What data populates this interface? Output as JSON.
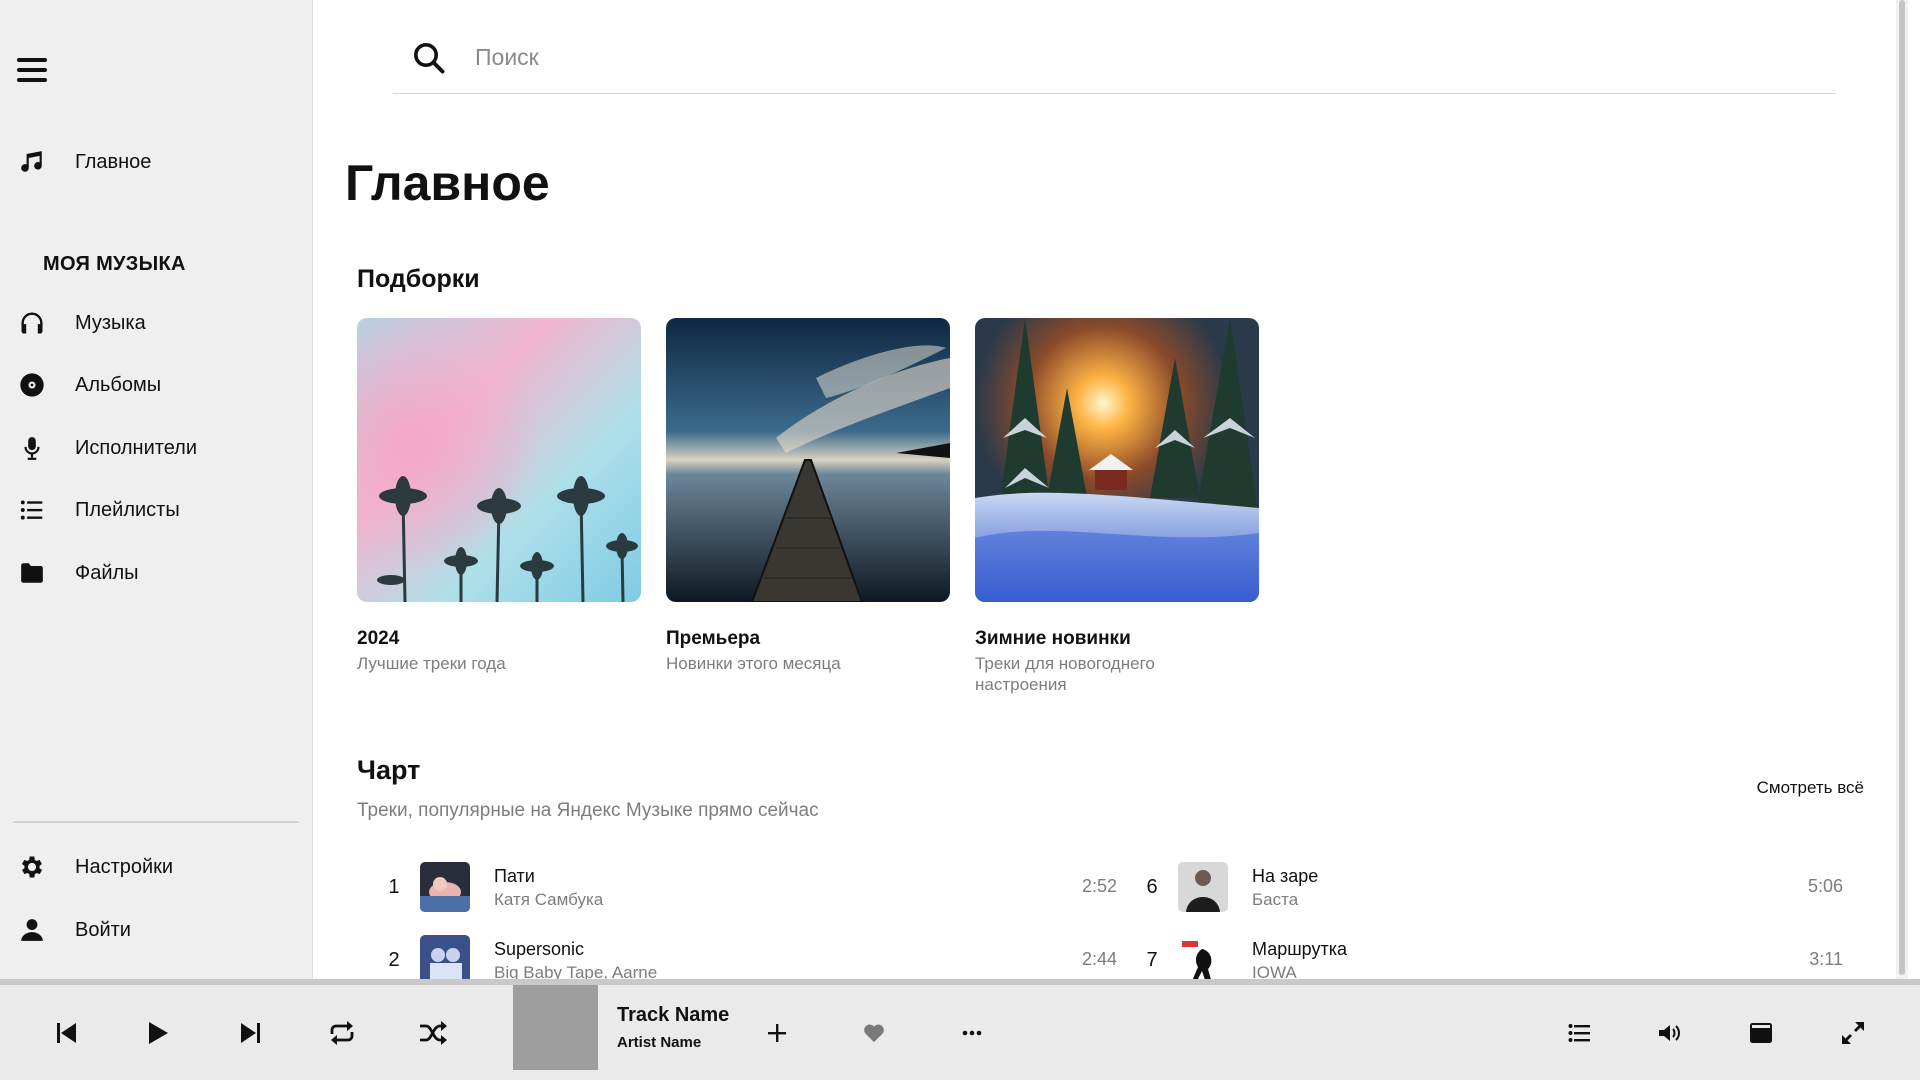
{
  "sidebar": {
    "home_label": "Главное",
    "section_title": "МОЯ МУЗЫКА",
    "items": [
      {
        "label": "Музыка",
        "icon": "headphones-icon"
      },
      {
        "label": "Альбомы",
        "icon": "disc-icon"
      },
      {
        "label": "Исполнители",
        "icon": "microphone-icon"
      },
      {
        "label": "Плейлисты",
        "icon": "list-icon"
      },
      {
        "label": "Файлы",
        "icon": "folder-icon"
      }
    ],
    "settings_label": "Настройки",
    "login_label": "Войти"
  },
  "search": {
    "placeholder": "Поиск"
  },
  "main": {
    "title": "Главное",
    "collections_title": "Подборки",
    "collections": [
      {
        "title": "2024",
        "description": "Лучшие треки года"
      },
      {
        "title": "Премьера",
        "description": "Новинки этого месяца"
      },
      {
        "title": "Зимние новинки",
        "description": "Треки для новогоднего настроения"
      }
    ],
    "chart": {
      "title": "Чарт",
      "subtitle": "Треки, популярные на Яндекс Музыке прямо сейчас",
      "see_all": "Смотреть всё",
      "tracks": [
        {
          "rank": "1",
          "name": "Пати",
          "artist": "Катя Самбука",
          "duration": "2:52"
        },
        {
          "rank": "2",
          "name": "Supersonic",
          "artist": "Big Baby Tape, Aarne",
          "duration": "2:44"
        },
        {
          "rank": "6",
          "name": "На заре",
          "artist": "Баста",
          "duration": "5:06"
        },
        {
          "rank": "7",
          "name": "Маршрутка",
          "artist": "IOWA",
          "duration": "3:11"
        }
      ]
    }
  },
  "player": {
    "track_name": "Track Name",
    "artist_name": "Artist Name"
  },
  "colors": {
    "sidebar_bg": "#efefef",
    "player_bg": "#eaeaea",
    "muted_text": "#7d7d7d"
  }
}
